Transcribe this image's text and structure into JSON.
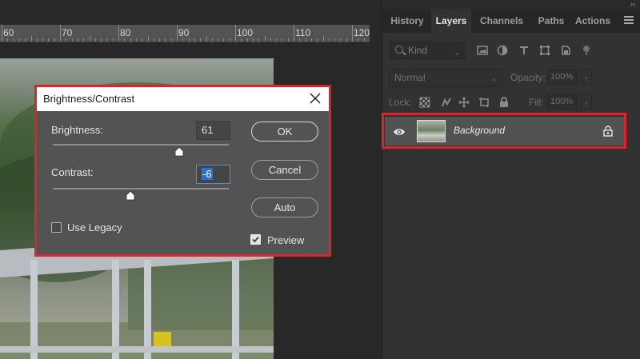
{
  "ruler": {
    "labels": [
      "60",
      "70",
      "80",
      "90",
      "100",
      "110",
      "120"
    ]
  },
  "dialog": {
    "title": "Brightness/Contrast",
    "brightness_label": "Brightness:",
    "brightness_value": "61",
    "brightness_level": 0.72,
    "contrast_label": "Contrast:",
    "contrast_value": "-6",
    "contrast_level": 0.44,
    "ok_label": "OK",
    "cancel_label": "Cancel",
    "auto_label": "Auto",
    "use_legacy_label": "Use Legacy",
    "use_legacy_checked": false,
    "preview_label": "Preview",
    "preview_checked": true
  },
  "panel": {
    "tabs": [
      "History",
      "Layers",
      "Channels",
      "Paths",
      "Actions"
    ],
    "active_tab": "Layers",
    "filter_placeholder": "Kind",
    "blend_mode": "Normal",
    "opacity_label": "Opacity:",
    "opacity_value": "100%",
    "lock_label": "Lock:",
    "fill_label": "Fill:",
    "fill_value": "100%",
    "layer_name": "Background"
  },
  "colors": {
    "highlight": "#e0232b",
    "panel_bg": "#323232",
    "dialog_bg": "#535353",
    "selection": "#2f6fd0"
  },
  "icons": {
    "filter": [
      "image-filter-icon",
      "adjustment-filter-icon",
      "type-filter-icon",
      "shape-filter-icon",
      "smart-object-filter-icon"
    ],
    "lock": [
      "lock-transparent-icon",
      "lock-image-icon",
      "lock-position-icon",
      "lock-artboard-icon",
      "lock-all-icon"
    ]
  }
}
